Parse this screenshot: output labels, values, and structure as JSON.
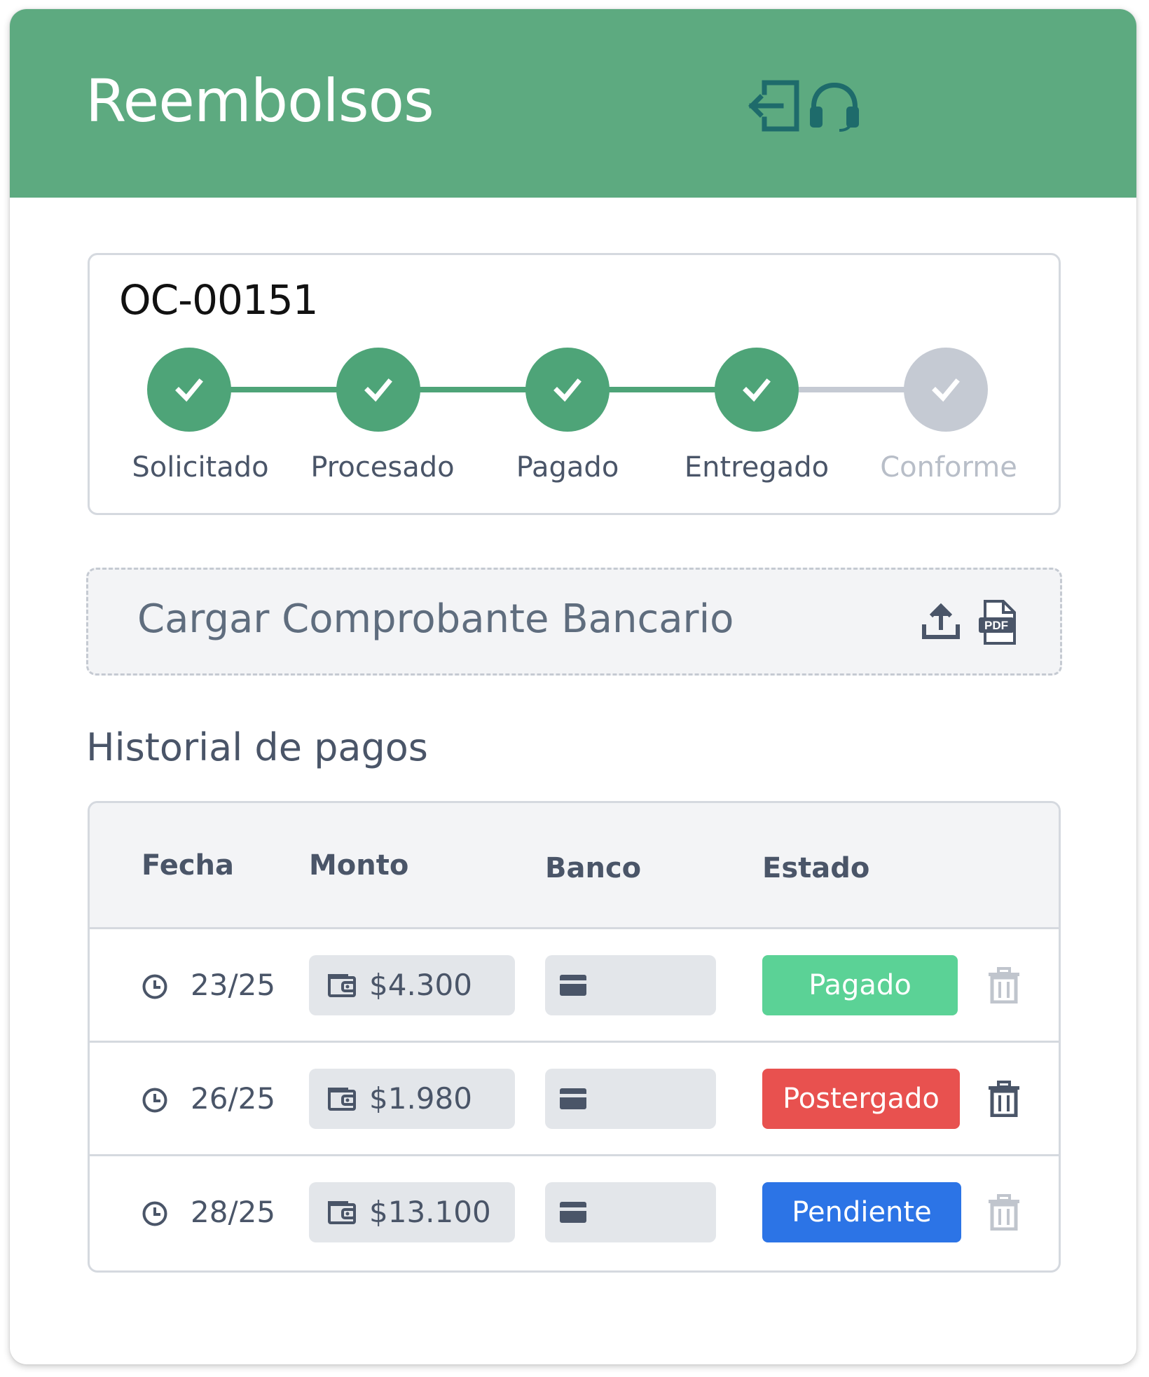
{
  "header": {
    "title": "Reembolsos",
    "background_color": "#5daa80",
    "icons": [
      "logout-icon",
      "headset-icon"
    ],
    "icon_color": "#1e6b6b"
  },
  "order": {
    "id": "OC-00151",
    "steps": [
      {
        "label": "Solicitado",
        "complete": true
      },
      {
        "label": "Procesado",
        "complete": true
      },
      {
        "label": "Pagado",
        "complete": true
      },
      {
        "label": "Entregado",
        "complete": true
      },
      {
        "label": "Conforme",
        "complete": false
      }
    ],
    "complete_color": "#4ea478",
    "incomplete_color": "#c5cad3"
  },
  "upload": {
    "label": "Cargar Comprobante Bancario",
    "icons": [
      "upload-icon",
      "pdf-icon"
    ]
  },
  "history": {
    "title": "Historial de pagos",
    "columns": {
      "date": "Fecha",
      "amount": "Monto",
      "bank": "Banco",
      "status": "Estado"
    },
    "rows": [
      {
        "date": "23/25",
        "amount": "$4.300",
        "status": "Pagado",
        "status_color": "#5bd296",
        "delete_enabled": false
      },
      {
        "date": "26/25",
        "amount": "$1.980",
        "status": "Postergado",
        "status_color": "#e8514f",
        "delete_enabled": true
      },
      {
        "date": "28/25",
        "amount": "$13.100",
        "status": "Pendiente",
        "status_color": "#2c74e6",
        "delete_enabled": false
      }
    ]
  }
}
